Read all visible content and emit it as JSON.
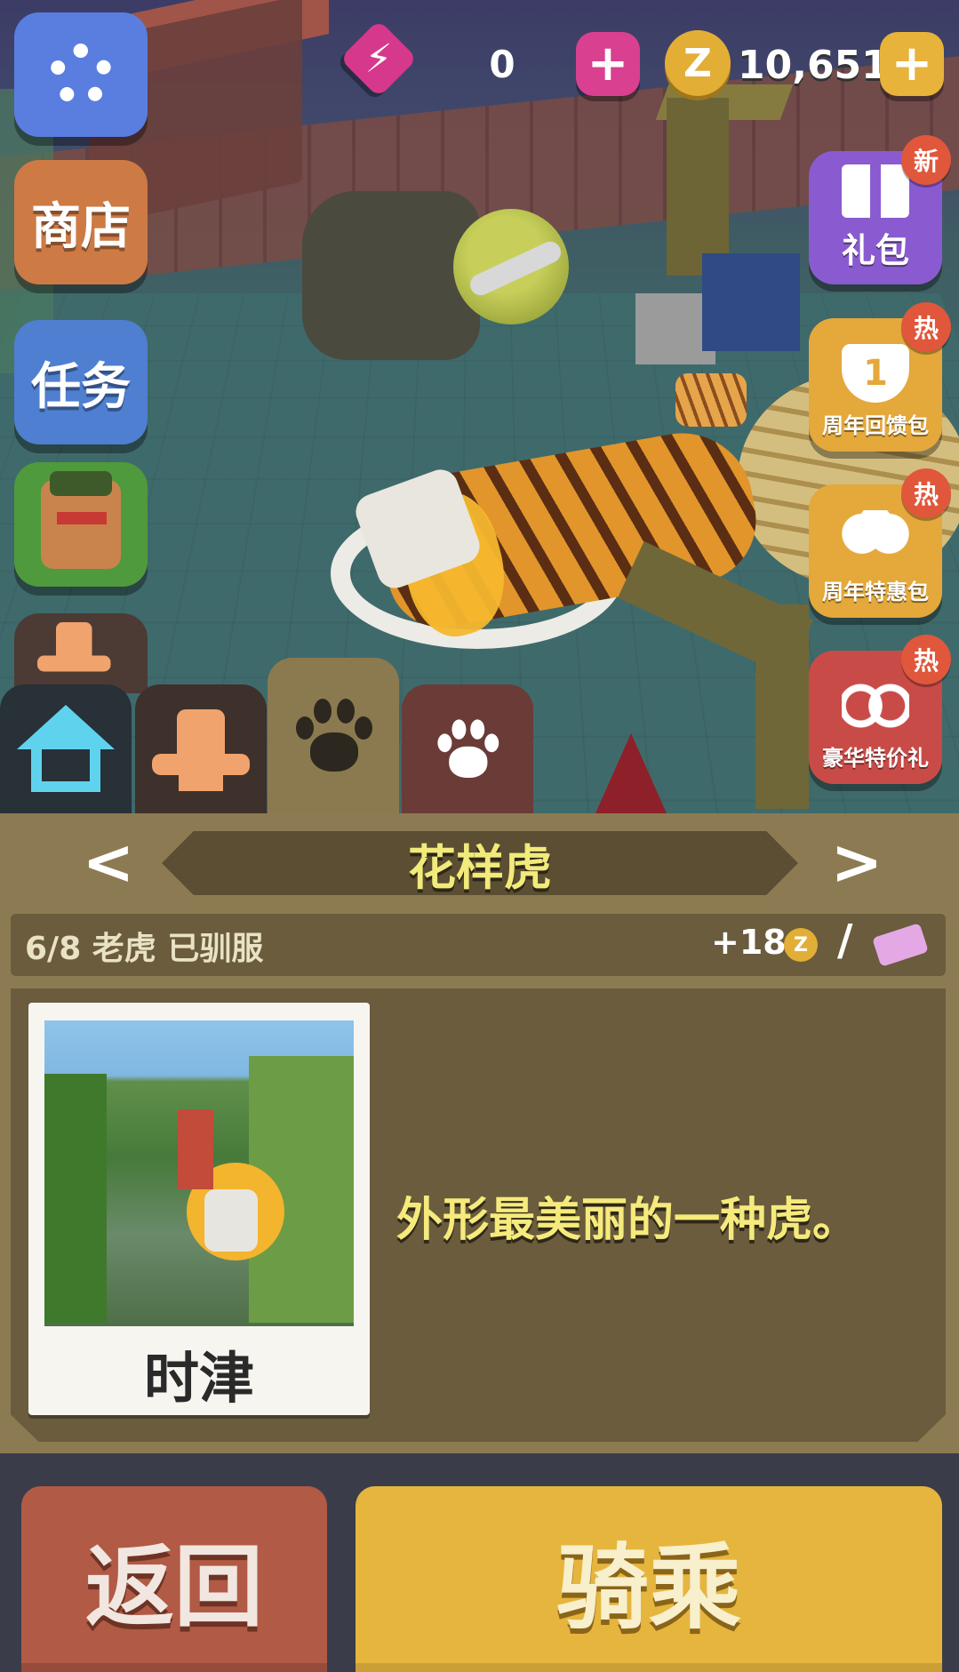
{
  "resources": {
    "energy_value": "0",
    "coin_value": "10,651",
    "coin_symbol": "Z",
    "plus": "+"
  },
  "left_menu": {
    "shop": "商店",
    "tasks": "任务"
  },
  "promos": [
    {
      "label": "礼包",
      "badge": "新"
    },
    {
      "label": "周年回馈包",
      "badge": "热",
      "number": "1"
    },
    {
      "label": "周年特惠包",
      "badge": "热"
    },
    {
      "label": "豪华特价礼",
      "badge": "热"
    }
  ],
  "tabs": [
    "home-icon",
    "hat-icon",
    "paw-icon",
    "paw-outline-icon"
  ],
  "animal": {
    "name": "花样虎",
    "prev": "<",
    "next": ">",
    "tamed": "6/8 老虎 已驯服",
    "reward": "+18",
    "reward_coin": "Z",
    "slash": "/",
    "card_caption": "时津",
    "description": "外形最美丽的一种虎。"
  },
  "actions": {
    "back": "返回",
    "ride": "骑乘"
  },
  "colors": {
    "panel": "#8c7b52",
    "panel_dark": "#6a5c3c",
    "title_text": "#f2ea7a",
    "back_button": "#b15a45",
    "ride_button": "#e6b53e"
  }
}
